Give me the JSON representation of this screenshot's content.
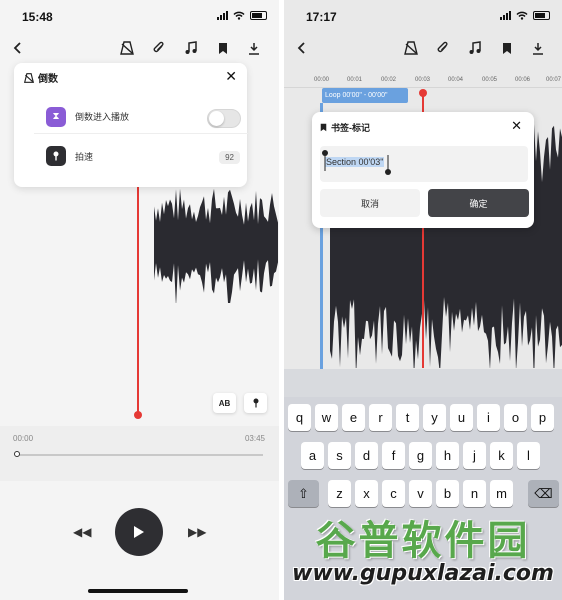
{
  "left": {
    "status_time": "15:48",
    "countdown_panel": {
      "title": "倒数",
      "toggle_label": "倒数进入播放",
      "toggle_on": false,
      "tempo_label": "拍速",
      "tempo_value": "92"
    },
    "ab_label": "AB",
    "timeline": {
      "start": "00:00",
      "end": "03:45"
    }
  },
  "right": {
    "status_time": "17:17",
    "ruler_ticks": [
      "00:00",
      "00:01",
      "00:02",
      "00:03",
      "00:04",
      "00:05",
      "00:06",
      "00:07"
    ],
    "loop_label": "Loop 00'00\" - 00'00\"",
    "bookmark_dialog": {
      "title": "书签-标记",
      "input_value": "Section 00'03\"",
      "cancel_label": "取消",
      "confirm_label": "确定"
    },
    "keyboard": {
      "row1": [
        "q",
        "w",
        "e",
        "r",
        "t",
        "y",
        "u",
        "i",
        "o",
        "p"
      ],
      "row2": [
        "a",
        "s",
        "d",
        "f",
        "g",
        "h",
        "j",
        "k",
        "l"
      ],
      "row3": [
        "z",
        "x",
        "c",
        "v",
        "b",
        "n",
        "m"
      ]
    }
  },
  "watermark": {
    "brand": "谷普软件园",
    "url": "www.gupuxlazai.com"
  },
  "colors": {
    "playhead": "#e53935",
    "loop": "#6aa1df",
    "accent_purple": "#8a5cd6",
    "wave": "#2a2a30"
  },
  "icons": [
    "back-icon",
    "metronome-off-icon",
    "paperclip-icon",
    "music-note-icon",
    "bookmark-icon",
    "download-icon",
    "hourglass-icon",
    "metronome-icon",
    "pin-icon",
    "rewind-icon",
    "play-icon",
    "fast-forward-icon",
    "shift-icon",
    "delete-icon"
  ]
}
